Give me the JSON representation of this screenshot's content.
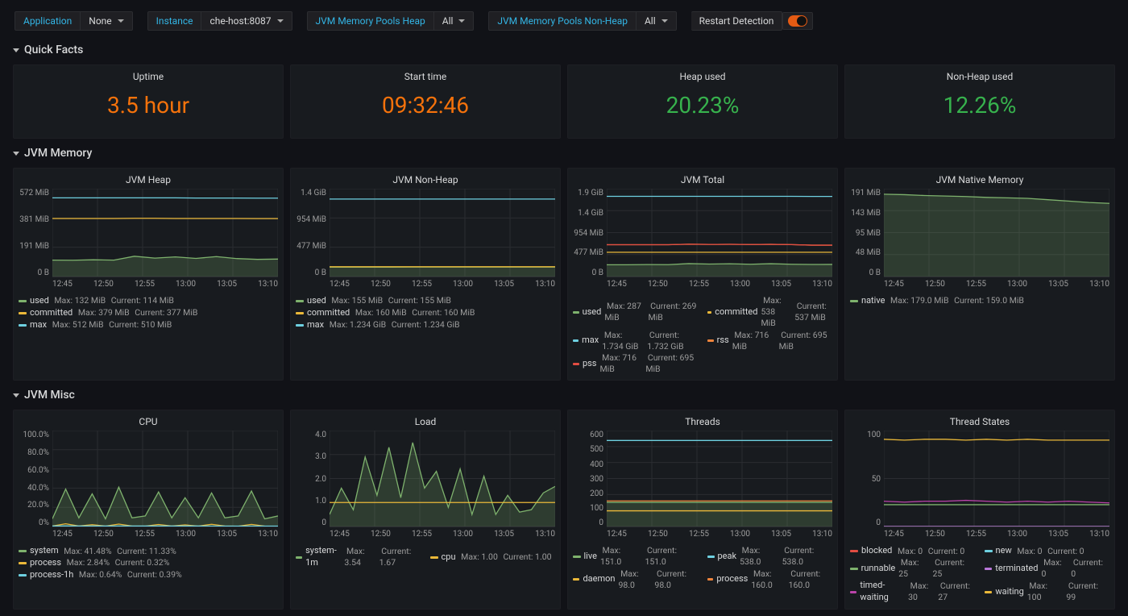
{
  "top_vars": {
    "application": {
      "label": "Application",
      "value": "None"
    },
    "instance": {
      "label": "Instance",
      "value": "che-host:8087"
    },
    "pools_heap": {
      "label": "JVM Memory Pools Heap",
      "value": "All"
    },
    "pools_nonheap": {
      "label": "JVM Memory Pools Non-Heap",
      "value": "All"
    },
    "restart_detection": {
      "label": "Restart Detection",
      "enabled": true
    }
  },
  "rows": {
    "quick_facts": {
      "title": "Quick Facts"
    },
    "jvm_memory": {
      "title": "JVM Memory"
    },
    "jvm_misc": {
      "title": "JVM Misc"
    }
  },
  "stat_panels": {
    "uptime": {
      "title": "Uptime",
      "value": "3.5 hour",
      "color": "orange"
    },
    "start_time": {
      "title": "Start time",
      "value": "09:32:46",
      "color": "orange"
    },
    "heap_used": {
      "title": "Heap used",
      "value": "20.23%",
      "color": "green"
    },
    "nonheap": {
      "title": "Non-Heap used",
      "value": "12.26%",
      "color": "green"
    }
  },
  "time_axis": [
    "12:45",
    "12:50",
    "12:55",
    "13:00",
    "13:05",
    "13:10"
  ],
  "chart_data": [
    {
      "id": "jvm_heap",
      "type": "line",
      "title": "JVM Heap",
      "y_ticks": [
        "572 MiB",
        "381 MiB",
        "191 MiB",
        "0 B"
      ],
      "ylim_mib": [
        0,
        572
      ],
      "x": [
        "12:45",
        "12:50",
        "12:55",
        "13:00",
        "13:05",
        "13:10"
      ],
      "series": [
        {
          "name": "used",
          "color": "#7EB26D",
          "max": "132 MiB",
          "current": "114 MiB",
          "values_mib": [
            107,
            106,
            109,
            107,
            132,
            120,
            128,
            118,
            130,
            117,
            112,
            114
          ]
        },
        {
          "name": "committed",
          "color": "#EAB839",
          "max": "379 MiB",
          "current": "377 MiB",
          "values_mib": [
            378,
            378,
            378,
            378,
            379,
            379,
            378,
            378,
            378,
            378,
            377,
            377
          ]
        },
        {
          "name": "max",
          "color": "#6ED0E0",
          "max": "512 MiB",
          "current": "510 MiB",
          "values_mib": [
            512,
            512,
            512,
            512,
            512,
            512,
            512,
            511,
            511,
            511,
            510,
            510
          ]
        }
      ]
    },
    {
      "id": "jvm_nonheap",
      "type": "line",
      "title": "JVM Non-Heap",
      "y_ticks": [
        "1.4 GiB",
        "954 MiB",
        "477 MiB",
        "0 B"
      ],
      "ylim_mib": [
        0,
        1434
      ],
      "x": [
        "12:45",
        "12:50",
        "12:55",
        "13:00",
        "13:05",
        "13:10"
      ],
      "series": [
        {
          "name": "used",
          "color": "#7EB26D",
          "max": "155 MiB",
          "current": "155 MiB",
          "values_mib": [
            154,
            154,
            154,
            154,
            155,
            155,
            155,
            155,
            155,
            155,
            155,
            155
          ]
        },
        {
          "name": "committed",
          "color": "#EAB839",
          "max": "160 MiB",
          "current": "160 MiB",
          "values_mib": [
            160,
            160,
            160,
            160,
            160,
            160,
            160,
            160,
            160,
            160,
            160,
            160
          ]
        },
        {
          "name": "max",
          "color": "#6ED0E0",
          "max": "1.234 GiB",
          "current": "1.234 GiB",
          "values_mib": [
            1264,
            1264,
            1264,
            1264,
            1264,
            1264,
            1264,
            1264,
            1264,
            1264,
            1264,
            1264
          ]
        }
      ]
    },
    {
      "id": "jvm_total",
      "type": "line",
      "title": "JVM Total",
      "y_ticks": [
        "1.9 GiB",
        "1.4 GiB",
        "954 MiB",
        "477 MiB",
        "0 B"
      ],
      "ylim_mib": [
        0,
        1946
      ],
      "x": [
        "12:45",
        "12:50",
        "12:55",
        "13:00",
        "13:05",
        "13:10"
      ],
      "series": [
        {
          "name": "used",
          "color": "#7EB26D",
          "max": "287 MiB",
          "current": "269 MiB",
          "values_mib": [
            262,
            262,
            265,
            263,
            287,
            276,
            283,
            273,
            285,
            272,
            268,
            269
          ]
        },
        {
          "name": "committed",
          "color": "#EAB839",
          "max": "538 MiB",
          "current": "537 MiB",
          "values_mib": [
            538,
            538,
            538,
            538,
            538,
            538,
            538,
            538,
            538,
            538,
            537,
            537
          ]
        },
        {
          "name": "max",
          "color": "#6ED0E0",
          "max": "1.734 GiB",
          "current": "1.732 GiB",
          "values_mib": [
            1776,
            1776,
            1776,
            1776,
            1776,
            1776,
            1776,
            1776,
            1776,
            1776,
            1774,
            1774
          ]
        },
        {
          "name": "rss",
          "color": "#EF843C",
          "max": "716 MiB",
          "current": "695 MiB",
          "values_mib": [
            705,
            705,
            706,
            706,
            716,
            712,
            714,
            709,
            713,
            707,
            696,
            695
          ]
        },
        {
          "name": "pss",
          "color": "#E24D42",
          "max": "716 MiB",
          "current": "695 MiB",
          "values_mib": [
            705,
            705,
            706,
            706,
            716,
            712,
            714,
            709,
            713,
            707,
            696,
            695
          ]
        }
      ]
    },
    {
      "id": "jvm_native",
      "type": "line",
      "title": "JVM Native Memory",
      "y_ticks": [
        "191 MiB",
        "143 MiB",
        "95 MiB",
        "48 MiB",
        "0 B"
      ],
      "ylim_mib": [
        0,
        191
      ],
      "x": [
        "12:45",
        "12:50",
        "12:55",
        "13:00",
        "13:05",
        "13:10"
      ],
      "series": [
        {
          "name": "native",
          "color": "#7EB26D",
          "max": "179.0 MiB",
          "current": "159.0 MiB",
          "values_mib": [
            179,
            178,
            176,
            175,
            174,
            172,
            171,
            170,
            167,
            164,
            161,
            159
          ]
        }
      ]
    },
    {
      "id": "cpu",
      "type": "line",
      "title": "CPU",
      "y_ticks": [
        "100.0%",
        "80.0%",
        "60.0%",
        "40.0%",
        "20.0%",
        "0%"
      ],
      "ylim_pct": [
        0,
        100
      ],
      "x": [
        "12:45",
        "12:50",
        "12:55",
        "13:00",
        "13:05",
        "13:10"
      ],
      "series": [
        {
          "name": "system",
          "color": "#7EB26D",
          "max": "41.48%",
          "current": "11.33%",
          "values_pct": [
            8,
            39,
            9,
            34,
            8,
            41,
            9,
            11,
            36,
            9,
            30,
            9,
            35,
            9,
            11,
            37,
            8,
            11
          ]
        },
        {
          "name": "process",
          "color": "#EAB839",
          "max": "2.84%",
          "current": "0.32%",
          "values_pct": [
            0.5,
            2.8,
            0.5,
            1.9,
            0.4,
            2.5,
            0.5,
            0.4,
            2.1,
            0.5,
            1.7,
            0.4,
            2.3,
            0.5,
            0.3,
            2.2,
            0.4,
            0.3
          ]
        },
        {
          "name": "process-1h",
          "color": "#6ED0E0",
          "max": "0.64%",
          "current": "0.39%",
          "values_pct": [
            0.5,
            0.6,
            0.5,
            0.5,
            0.5,
            0.5,
            0.5,
            0.5,
            0.5,
            0.5,
            0.5,
            0.5,
            0.4,
            0.4,
            0.4,
            0.4,
            0.4,
            0.4
          ]
        }
      ]
    },
    {
      "id": "load",
      "type": "line",
      "title": "Load",
      "y_ticks": [
        "4.0",
        "3.0",
        "2.0",
        "1.0",
        "0"
      ],
      "ylim": [
        0,
        4.0
      ],
      "x": [
        "12:45",
        "12:50",
        "12:55",
        "13:00",
        "13:05",
        "13:10"
      ],
      "series": [
        {
          "name": "system-1m",
          "color": "#7EB26D",
          "max": "3.54",
          "current": "1.67",
          "values": [
            0.5,
            1.6,
            0.7,
            2.9,
            1.3,
            3.3,
            1.2,
            3.5,
            1.6,
            2.3,
            0.8,
            2.4,
            0.5,
            2.1,
            0.5,
            1.3,
            0.6,
            0.7,
            1.4,
            1.67
          ]
        },
        {
          "name": "cpu",
          "color": "#EAB839",
          "max": "1.00",
          "current": "1.00",
          "values": [
            1,
            1,
            1,
            1,
            1,
            1,
            1,
            1,
            1,
            1,
            1,
            1,
            1,
            1,
            1,
            1,
            1,
            1,
            1,
            1
          ]
        }
      ]
    },
    {
      "id": "threads",
      "type": "line",
      "title": "Threads",
      "y_ticks": [
        "600",
        "500",
        "400",
        "300",
        "200",
        "100",
        "0"
      ],
      "ylim": [
        0,
        600
      ],
      "x": [
        "12:45",
        "12:50",
        "12:55",
        "13:00",
        "13:05",
        "13:10"
      ],
      "series": [
        {
          "name": "live",
          "color": "#7EB26D",
          "max": "151.0",
          "current": "151.0",
          "values": [
            151,
            151,
            151,
            151,
            151,
            151,
            151,
            151,
            151,
            151,
            151,
            151
          ]
        },
        {
          "name": "peak",
          "color": "#6ED0E0",
          "max": "538.0",
          "current": "538.0",
          "values": [
            538,
            538,
            538,
            538,
            538,
            538,
            538,
            538,
            538,
            538,
            538,
            538
          ]
        },
        {
          "name": "daemon",
          "color": "#EAB839",
          "max": "98.0",
          "current": "98.0",
          "values": [
            98,
            98,
            98,
            98,
            98,
            98,
            98,
            98,
            98,
            98,
            98,
            98
          ]
        },
        {
          "name": "process",
          "color": "#EF843C",
          "max": "160.0",
          "current": "160.0",
          "values": [
            160,
            160,
            160,
            160,
            160,
            160,
            160,
            160,
            160,
            160,
            160,
            160
          ]
        }
      ]
    },
    {
      "id": "thread_states",
      "type": "line",
      "title": "Thread States",
      "y_ticks": [
        "100",
        "50",
        "0"
      ],
      "ylim": [
        0,
        110
      ],
      "x": [
        "12:45",
        "12:50",
        "12:55",
        "13:00",
        "13:05",
        "13:10"
      ],
      "series": [
        {
          "name": "blocked",
          "color": "#E24D42",
          "max": "0",
          "current": "0",
          "values": [
            0,
            0,
            0,
            0,
            0,
            0,
            0,
            0,
            0,
            0,
            0,
            0
          ]
        },
        {
          "name": "new",
          "color": "#6ED0E0",
          "max": "0",
          "current": "0",
          "values": [
            0,
            0,
            0,
            0,
            0,
            0,
            0,
            0,
            0,
            0,
            0,
            0
          ]
        },
        {
          "name": "runnable",
          "color": "#7EB26D",
          "max": "25",
          "current": "25",
          "values": [
            25,
            25,
            25,
            25,
            25,
            25,
            25,
            25,
            25,
            25,
            25,
            25
          ]
        },
        {
          "name": "terminated",
          "color": "#B877D9",
          "max": "0",
          "current": "0",
          "values": [
            0,
            0,
            0,
            0,
            0,
            0,
            0,
            0,
            0,
            0,
            0,
            0
          ]
        },
        {
          "name": "timed-waiting",
          "color": "#BA43A9",
          "max": "30",
          "current": "27",
          "values": [
            29,
            28,
            29,
            29,
            30,
            29,
            28,
            29,
            28,
            29,
            28,
            27
          ]
        },
        {
          "name": "waiting",
          "color": "#EAB839",
          "max": "100",
          "current": "99",
          "values": [
            100,
            99,
            100,
            100,
            99,
            100,
            99,
            100,
            99,
            99,
            99,
            99
          ]
        }
      ]
    }
  ]
}
